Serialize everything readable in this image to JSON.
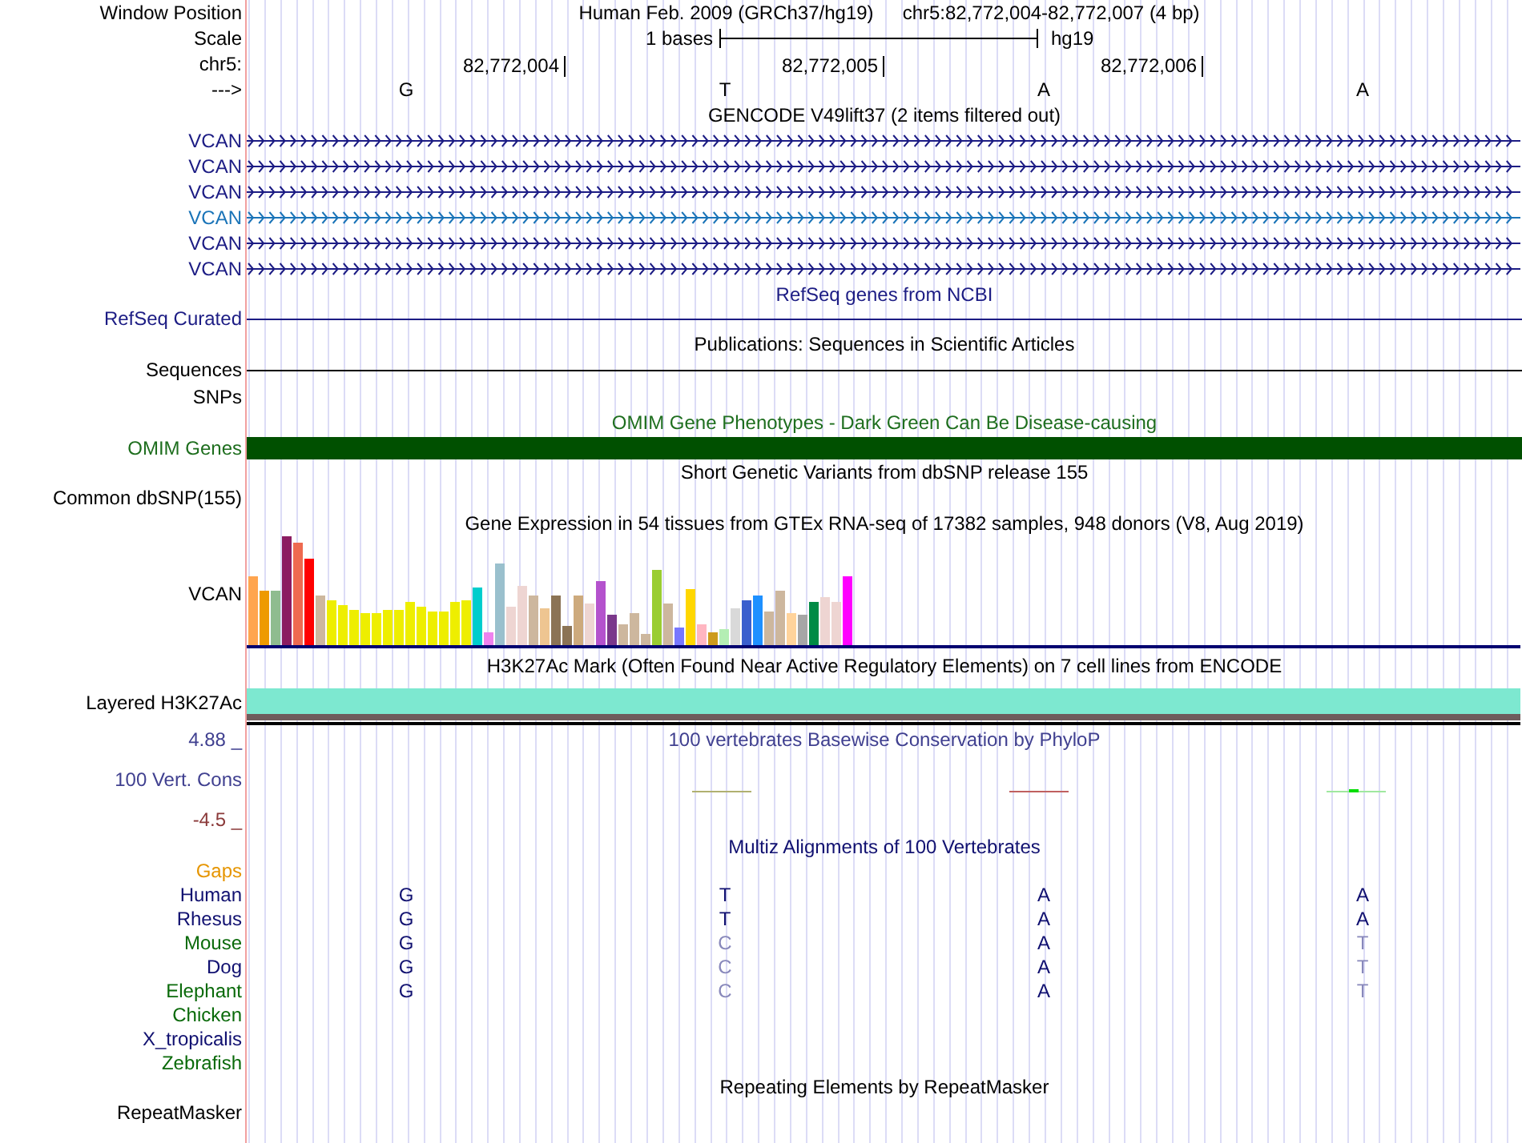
{
  "position": {
    "label": "Window Position",
    "assembly": "Human Feb. 2009 (GRCh37/hg19)",
    "range": "chr5:82,772,004-82,772,007 (4 bp)"
  },
  "scale": {
    "label": "Scale",
    "span": "1 bases",
    "assembly": "hg19"
  },
  "coordinates": {
    "label": "chr5:",
    "ticks": [
      "82,772,004",
      "82,772,005",
      "82,772,006"
    ]
  },
  "bases": {
    "label": "--->",
    "values": [
      "G",
      "T",
      "A",
      "A"
    ]
  },
  "tracks": [
    {
      "kind": "genes",
      "title": "GENCODE V49lift37 (2 items filtered out)",
      "color": "#000000",
      "items": [
        {
          "name": "VCAN",
          "color": "#1c1c84"
        },
        {
          "name": "VCAN",
          "color": "#1c1c84"
        },
        {
          "name": "VCAN",
          "color": "#1c1c84"
        },
        {
          "name": "VCAN",
          "color": "#1a74b8"
        },
        {
          "name": "VCAN",
          "color": "#1c1c84"
        },
        {
          "name": "VCAN",
          "color": "#1c1c84"
        }
      ]
    },
    {
      "kind": "line",
      "title": "RefSeq genes from NCBI",
      "label": "RefSeq Curated",
      "color": "#1c1c84"
    },
    {
      "kind": "line",
      "title": "Publications: Sequences in Scientific Articles",
      "label": "Sequences",
      "color": "#000000"
    },
    {
      "kind": "empty",
      "label": "SNPs",
      "color": "#000000"
    },
    {
      "kind": "bar",
      "title": "OMIM Gene Phenotypes - Dark Green Can Be Disease-causing",
      "label": "OMIM Genes",
      "color": "#1e6e1e"
    },
    {
      "kind": "empty",
      "title": "Short Genetic Variants from dbSNP release 155",
      "label": "Common dbSNP(155)",
      "color": "#000000"
    },
    {
      "kind": "expression",
      "title": "Gene Expression in 54 tissues from GTEx RNA-seq of 17382 samples, 948 donors (V8, Aug 2019)",
      "label": "VCAN",
      "color": "#000000"
    },
    {
      "kind": "signal",
      "title": "H3K27Ac Mark (Often Found Near Active Regulatory Elements) on 7 cell lines from ENCODE",
      "label": "Layered H3K27Ac",
      "color": "#000000"
    },
    {
      "kind": "conservation",
      "title": "100 vertebrates Basewise Conservation by PhyloP",
      "label": "100 Vert. Cons",
      "max": "4.88 _",
      "min": "-4.5 _",
      "color": "#404090"
    },
    {
      "kind": "alignment",
      "title": "Multiz Alignments of 100 Vertebrates",
      "gaps": "Gaps",
      "color": "#101070",
      "species": [
        {
          "name": "Human",
          "color": "#101070",
          "bases": [
            {
              "base": "G",
              "match": true
            },
            {
              "base": "T",
              "match": true
            },
            {
              "base": "A",
              "match": true
            },
            {
              "base": "A",
              "match": true
            }
          ]
        },
        {
          "name": "Rhesus",
          "color": "#101070",
          "bases": [
            {
              "base": "G",
              "match": true
            },
            {
              "base": "T",
              "match": true
            },
            {
              "base": "A",
              "match": true
            },
            {
              "base": "A",
              "match": true
            }
          ]
        },
        {
          "name": "Mouse",
          "color": "#0a6a0a",
          "bases": [
            {
              "base": "G",
              "match": true
            },
            {
              "base": "C",
              "match": false
            },
            {
              "base": "A",
              "match": true
            },
            {
              "base": "T",
              "match": false
            }
          ]
        },
        {
          "name": "Dog",
          "color": "#101070",
          "bases": [
            {
              "base": "G",
              "match": true
            },
            {
              "base": "C",
              "match": false
            },
            {
              "base": "A",
              "match": true
            },
            {
              "base": "T",
              "match": false
            }
          ]
        },
        {
          "name": "Elephant",
          "color": "#0a6a0a",
          "bases": [
            {
              "base": "G",
              "match": true
            },
            {
              "base": "C",
              "match": false
            },
            {
              "base": "A",
              "match": true
            },
            {
              "base": "T",
              "match": false
            }
          ]
        },
        {
          "name": "Chicken",
          "color": "#0a6a0a"
        },
        {
          "name": "X_tropicalis",
          "color": "#101070"
        },
        {
          "name": "Zebrafish",
          "color": "#0a6a0a"
        }
      ]
    },
    {
      "kind": "empty",
      "title": "Repeating Elements by RepeatMasker",
      "label": "RepeatMasker",
      "color": "#000000"
    }
  ]
}
